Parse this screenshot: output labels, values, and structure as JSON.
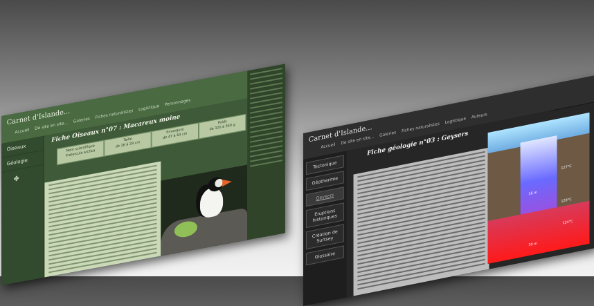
{
  "left_site": {
    "title": "Carnet d'Islande...",
    "nav": [
      "Accueil",
      "De site en site...",
      "Galeries",
      "Fiches naturalistes",
      "Logistique",
      "Personnages"
    ],
    "sidebar": [
      "Oiseaux",
      "Géologie"
    ],
    "fiche_title": "Fiche Oiseaux n°07 : Macareux moine",
    "info_cells": [
      {
        "label": "Nom scientifique",
        "value": "Fratercula arctica"
      },
      {
        "label": "Taille",
        "value": "de 26 à 29 cm"
      },
      {
        "label": "Envergure",
        "value": "de 47 à 63 cm"
      },
      {
        "label": "Poids",
        "value": "de 320 à 550 g"
      }
    ]
  },
  "right_site": {
    "title": "Carnet d'Islande...",
    "nav": [
      "Accueil",
      "De site en site...",
      "Galeries",
      "Fiches naturalistes",
      "Logistique",
      "Auteurs"
    ],
    "sidebar": [
      "Tectonique",
      "Géothermie",
      "Geysers",
      "Eruptions historiques",
      "Création de Surtsey",
      "Glossaire"
    ],
    "active_sidebar": "Geysers",
    "fiche_title": "Fiche géologie n°03 : Geysers",
    "diagram_labels": [
      "30 m",
      "16 m",
      "127°C",
      "128°C",
      "124°C"
    ]
  },
  "colors": {
    "left_bg": "#3e5a38",
    "right_bg": "#262626",
    "water_hot": "#ff1a1a",
    "water_cold": "#6a6aff"
  }
}
